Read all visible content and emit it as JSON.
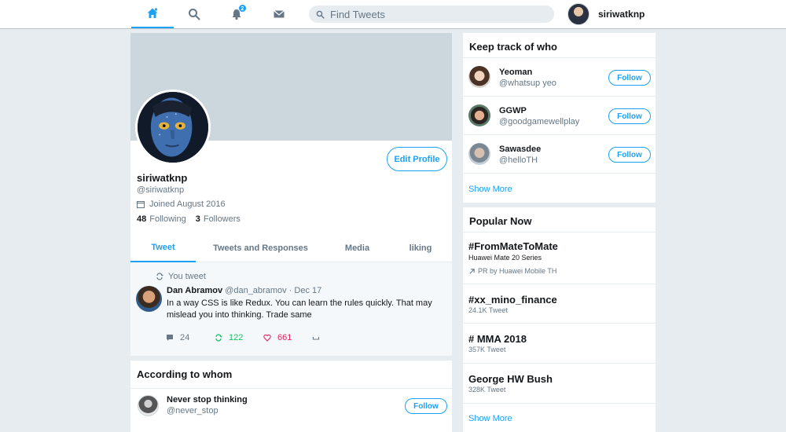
{
  "topbar": {
    "bell_badge": "2",
    "search_placeholder": "Find Tweets",
    "username": "siriwatknp"
  },
  "profile": {
    "edit_label": "Edit Profile",
    "name": "siriwatknp",
    "handle": "@siriwatknp",
    "joined": "Joined August 2016",
    "following_count": "48",
    "following_label": "Following",
    "followers_count": "3",
    "followers_label": "Followers",
    "tabs": [
      "Tweet",
      "Tweets and Responses",
      "Media",
      "liking"
    ]
  },
  "tweet": {
    "retweet_label": "You tweet",
    "author": "Dan Abramov",
    "meta": "@dan_abramov · Dec 17",
    "text": "In a way CSS is like Redux. You can learn the rules quickly. That may mislead you into thinking. Trade same",
    "replies": "24",
    "retweets": "122",
    "likes": "661"
  },
  "whom": {
    "title": "According to whom",
    "items": [
      {
        "name": "Never stop thinking",
        "handle": "@never_stop",
        "button": "Follow"
      }
    ]
  },
  "keep": {
    "title": "Keep track of who",
    "items": [
      {
        "name": "Yeoman",
        "handle": "@whatsup yeo",
        "button": "Follow"
      },
      {
        "name": "GGWP",
        "handle": "@goodgamewellplay",
        "button": "Follow"
      },
      {
        "name": "Sawasdee",
        "handle": "@helloTH",
        "button": "Follow"
      }
    ],
    "show_more": "Show More"
  },
  "popular": {
    "title": "Popular Now",
    "items": [
      {
        "tag": "#FromMateToMate",
        "sub": "Huawei Mate 20 Series",
        "promo": "PR by Huawei Mobile TH"
      },
      {
        "tag": "#xx_mino_finance",
        "count": "24.1K Tweet"
      },
      {
        "tag": "# MMA 2018",
        "count": "357K Tweet"
      },
      {
        "tag": "George HW Bush",
        "count": "328K Tweet"
      }
    ],
    "show_more": "Show More"
  },
  "colors": {
    "accent": "#1da1f2",
    "retweet": "#17bf63",
    "like": "#e0245e",
    "background": "#e6ecf0"
  },
  "icons": [
    "home-icon",
    "search-icon",
    "bell-icon",
    "mail-icon",
    "calendar-icon",
    "retweet-icon",
    "reply-icon",
    "heart-icon",
    "dm-icon",
    "promoted-icon"
  ]
}
